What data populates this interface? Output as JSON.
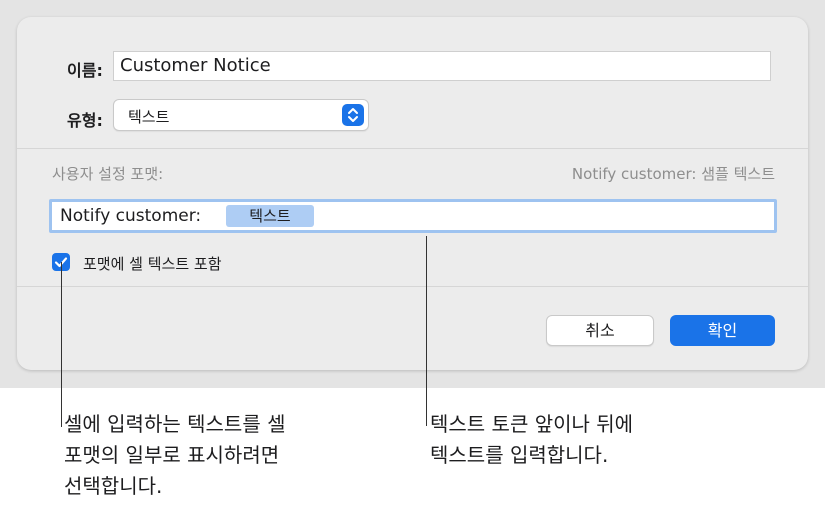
{
  "dialog": {
    "name_label": "이름:",
    "name_value": "Customer Notice",
    "type_label": "유형:",
    "type_value": "텍스트",
    "custom_format_label": "사용자 설정 포맷:",
    "sample_text": "Notify customer: 샘플 텍스트",
    "format_prefix": "Notify customer:",
    "format_token": "텍스트",
    "include_cell_text_label": "포맷에 셀 텍스트 포함",
    "include_cell_text_checked": true,
    "cancel_label": "취소",
    "ok_label": "확인"
  },
  "callouts": {
    "left": "셀에 입력하는 텍스트를 셀\n포맷의 일부로 표시하려면\n선택합니다.",
    "right": "텍스트 토큰 앞이나 뒤에\n텍스트를 입력합니다."
  },
  "colors": {
    "accent": "#1a73e8",
    "token_bg": "#aecdf4",
    "focus_ring": "#9ec3f0",
    "dialog_bg": "#ececec"
  },
  "icons": {
    "stepper": "chevron-up-down-icon",
    "checkbox": "checkmark-icon"
  }
}
